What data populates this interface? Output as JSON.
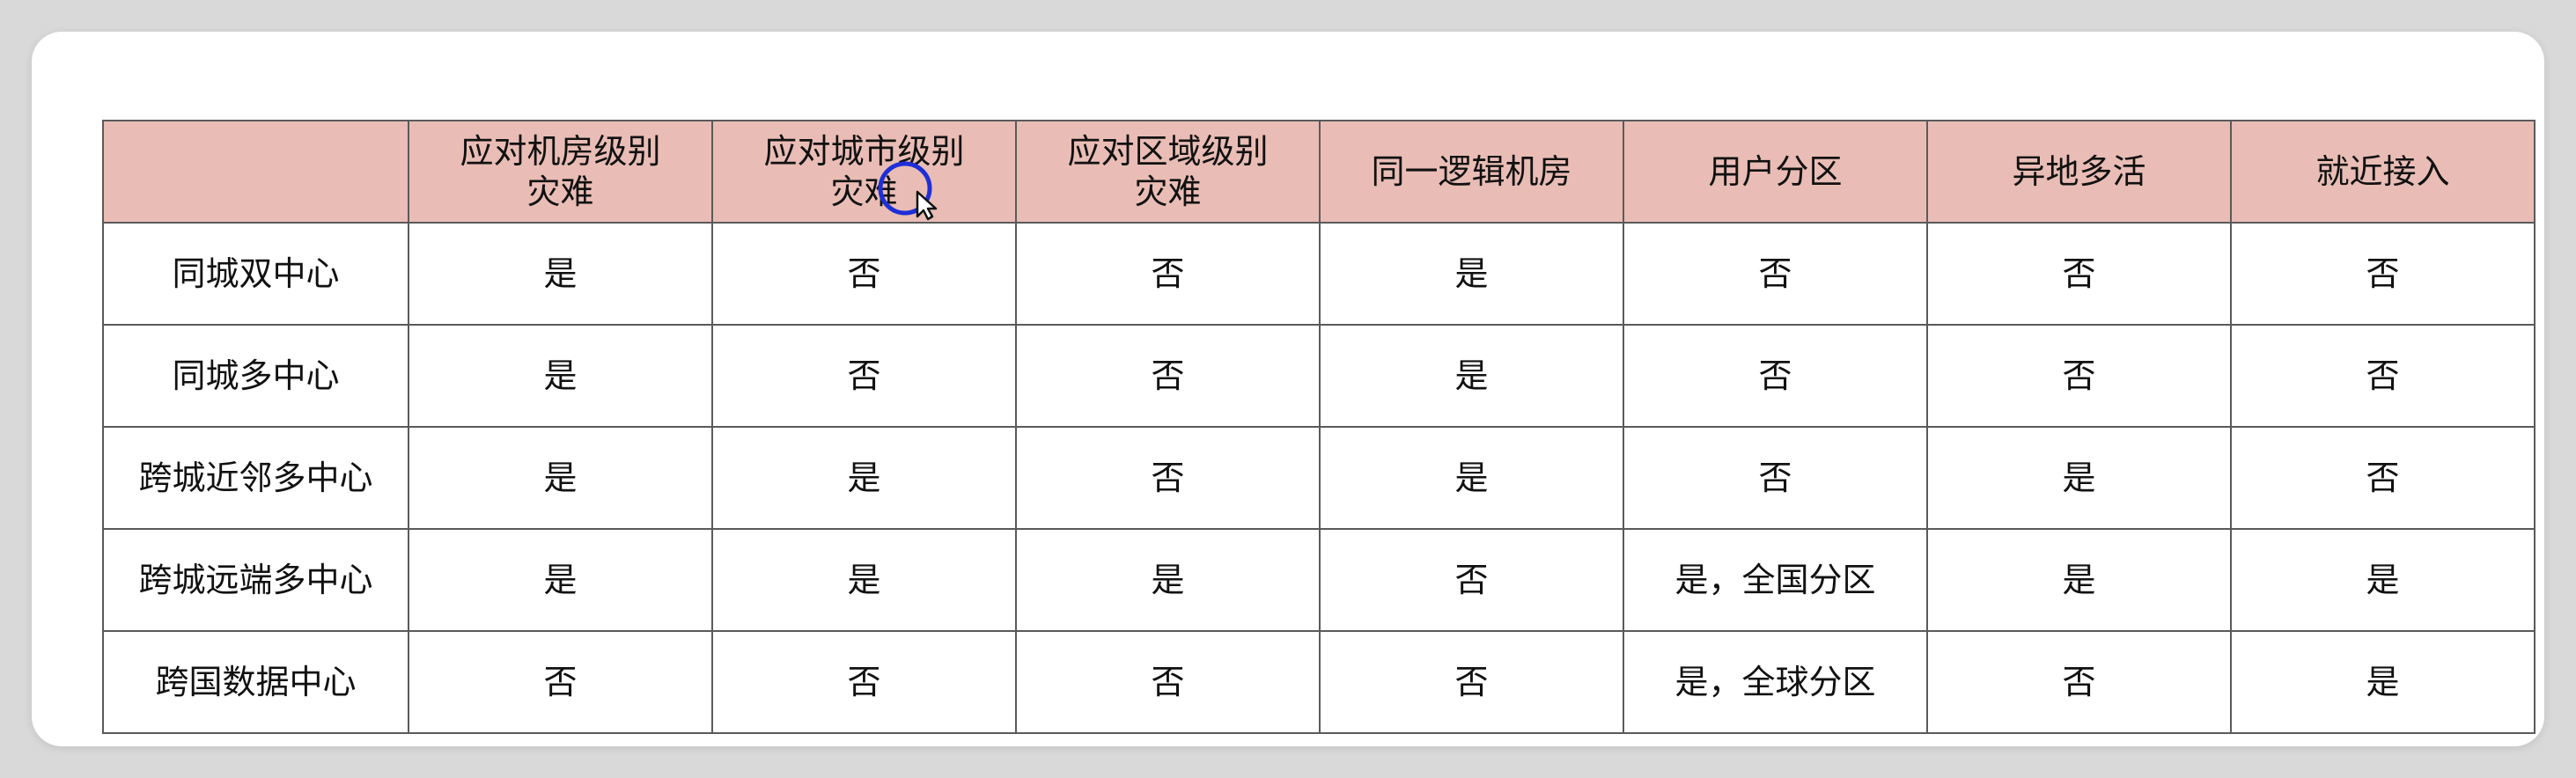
{
  "table": {
    "headers": [
      "",
      "应对机房级别\n灾难",
      "应对城市级别\n灾难",
      "应对区域级别\n灾难",
      "同一逻辑机房",
      "用户分区",
      "异地多活",
      "就近接入"
    ],
    "rows": [
      {
        "label": "同城双中心",
        "cells": [
          "是",
          "否",
          "否",
          "是",
          "否",
          "否",
          "否"
        ]
      },
      {
        "label": "同城多中心",
        "cells": [
          "是",
          "否",
          "否",
          "是",
          "否",
          "否",
          "否"
        ]
      },
      {
        "label": "跨城近邻多中心",
        "cells": [
          "是",
          "是",
          "否",
          "是",
          "否",
          "是",
          "否"
        ]
      },
      {
        "label": "跨城远端多中心",
        "cells": [
          "是",
          "是",
          "是",
          "否",
          "是，全国分区",
          "是",
          "是"
        ]
      },
      {
        "label": "跨国数据中心",
        "cells": [
          "否",
          "否",
          "否",
          "否",
          "是，全球分区",
          "否",
          "是"
        ]
      }
    ]
  },
  "colors": {
    "header_bg": "#e9bdb5",
    "no_text": "#b8141c",
    "yes_text": "#111111",
    "cursor_ring": "#1f2fd6"
  },
  "icons": {
    "cursor": "mouse-pointer-icon"
  }
}
